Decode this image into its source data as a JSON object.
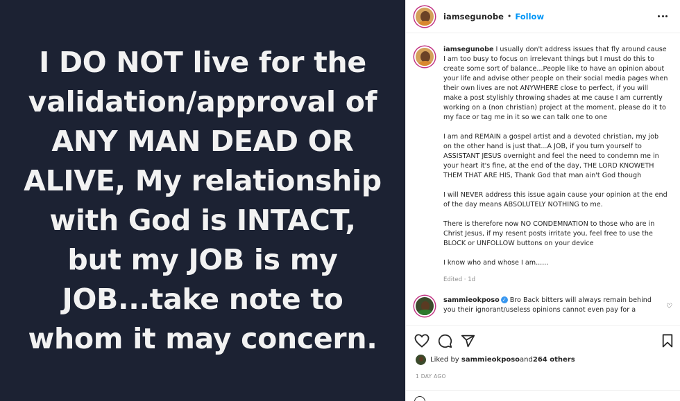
{
  "post_image": {
    "text": "I DO NOT live for the\nvalidation/approval of\nANY MAN DEAD OR\nALIVE, My relationship\nwith God is INTACT,\nbut my JOB is my\nJOB...take note to\nwhom it may concern."
  },
  "header": {
    "username": "iamsegunobe",
    "separator": "•",
    "follow_label": "Follow"
  },
  "caption": {
    "username": "iamsegunobe",
    "paragraphs": [
      "I usually don't address issues that fly around cause I am too busy to focus on irrelevant things but I must do this to create some sort of balance...People like to have an opinion about your life and advise other people on their social media pages when their own lives are not ANYWHERE close to perfect, if you will make a post stylishly throwing shades at me cause I am currently working on a (non christian) project at the moment, please do it to my face or tag me in it so we can talk one to one",
      "I am and REMAIN a gospel artist and a devoted christian, my job on the other hand is just that...A JOB, if you turn yourself to ASSISTANT JESUS overnight and feel the need to condemn me in your heart it's fine, at the end of the day, THE LORD KNOWETH THEM THAT ARE HIS, Thank God that man ain't God though",
      "I will NEVER address this issue again cause your opinion at the end of the day means ABSOLUTELY NOTHING to me.",
      "There is therefore now NO CONDEMNATION to those who are in Christ Jesus, if my resent posts irritate you, feel free to use the BLOCK or UNFOLLOW buttons on your device",
      "I know who and whose I am......"
    ],
    "meta": "Edited · 1d"
  },
  "comment": {
    "username": "sammieokposo",
    "text": "Bro Back bitters will always remain behind you their ignorant/useless opinions cannot even pay for a"
  },
  "likes": {
    "prefix": "Liked by ",
    "user": "sammieokposo",
    "and": " and ",
    "others": "264 others"
  },
  "timestamp": "1 DAY AGO",
  "colors": {
    "image_background": "#1c2233",
    "link_blue": "#0095f6",
    "verified_blue": "#3897f0"
  },
  "icons": [
    "more-horizontal-icon",
    "heart-icon",
    "comment-icon",
    "share-icon",
    "bookmark-icon",
    "verified-icon",
    "emoji-icon"
  ]
}
